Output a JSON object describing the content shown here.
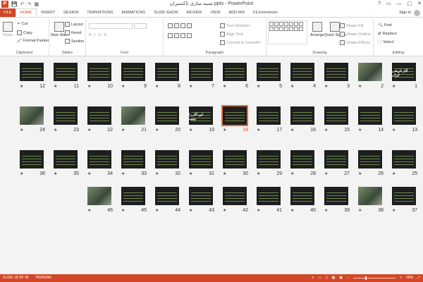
{
  "titlebar": {
    "title": "شبیه سازی تاکسیران.pptx - PowerPoint",
    "qat": [
      "💾",
      "↶",
      "↷",
      "▦"
    ],
    "window_buttons": [
      "?",
      "▭",
      "—",
      "▢",
      "✕"
    ]
  },
  "tabs": [
    "FILE",
    "HOME",
    "INSERT",
    "DESIGN",
    "TRANSITIONS",
    "ANIMATIONS",
    "SLIDE SHOW",
    "REVIEW",
    "VIEW",
    "ADD-INS",
    "FILEminimizer"
  ],
  "active_tab": "HOME",
  "signin": "Sign in",
  "ribbon": {
    "clipboard": {
      "label": "Clipboard",
      "paste": "Paste",
      "cut": "Cut",
      "copy": "Copy",
      "format_painter": "Format Painter"
    },
    "slides": {
      "label": "Slides",
      "new_slide": "New Slide",
      "layout": "Layout",
      "reset": "Reset",
      "section": "Section"
    },
    "font": {
      "label": "Font"
    },
    "paragraph": {
      "label": "Paragraph",
      "text_direction": "Text Direction",
      "align_text": "Align Text",
      "convert": "Convert to SmartArt"
    },
    "drawing": {
      "label": "Drawing",
      "arrange": "Arrange",
      "quick_styles": "Quick Styles",
      "shape_fill": "Shape Fill",
      "shape_outline": "Shape Outline",
      "shape_effects": "Shape Effects"
    },
    "editing": {
      "label": "Editing",
      "find": "Find",
      "replace": "Replace",
      "select": "Select"
    }
  },
  "slides": {
    "rows": [
      [
        1,
        2,
        3,
        4,
        5,
        6,
        7,
        8,
        9,
        10,
        11,
        12
      ],
      [
        13,
        14,
        15,
        16,
        17,
        18,
        19,
        20,
        21,
        22,
        23,
        24
      ],
      [
        25,
        26,
        27,
        28,
        29,
        30,
        31,
        32,
        33,
        34,
        35,
        36
      ],
      [
        37,
        38,
        39,
        40,
        41,
        42,
        43,
        44,
        45,
        46
      ]
    ],
    "selected": 18,
    "title_slide_text": "آثار تاریخی ایران",
    "slide_19_text": "این آثار را ببینید"
  },
  "status": {
    "slide_info": "SLIDE 18 OF 46",
    "language": "PERSIAN",
    "zoom": "30%",
    "zoom_fraction": 0.3
  },
  "colors": {
    "accent": "#d24726",
    "selection": "#e8693a"
  }
}
